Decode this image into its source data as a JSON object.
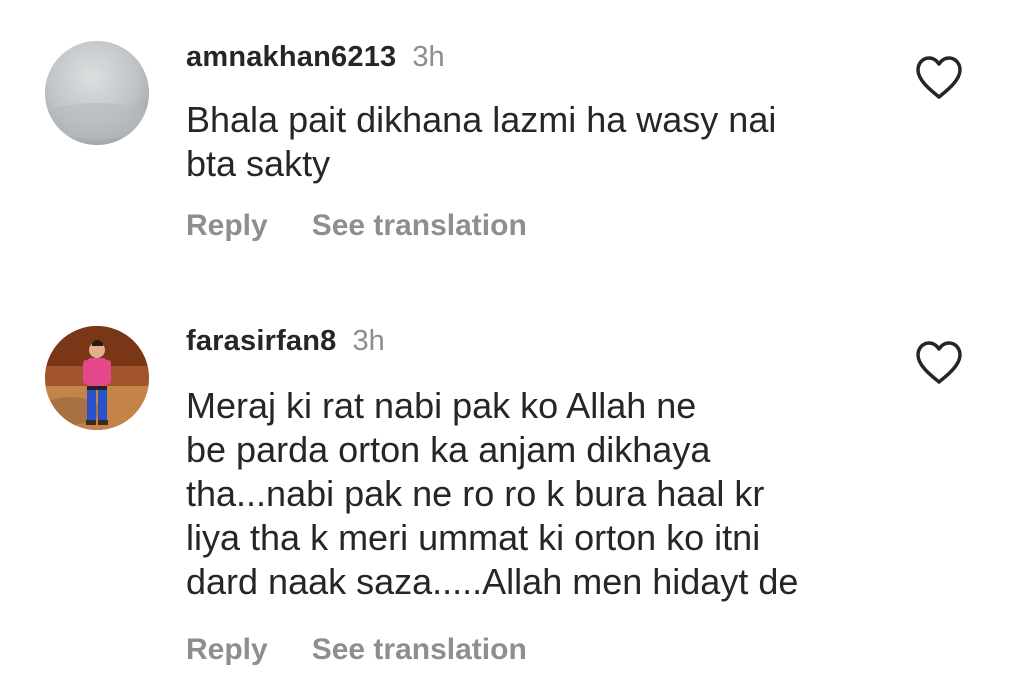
{
  "comments": [
    {
      "username": "amnakhan6213",
      "time": "3h",
      "text_lines": [
        "Bhala pait dikhana lazmi ha wasy nai",
        "bta sakty"
      ],
      "reply_label": "Reply",
      "translate_label": "See translation",
      "avatar_icon": "blurred-grey-profile-photo",
      "like_icon": "heart-outline-icon"
    },
    {
      "username": "farasirfan8",
      "time": "3h",
      "text_lines": [
        "Meraj ki rat nabi pak ko Allah ne",
        "be parda orton ka anjam dikhaya",
        "tha...nabi pak ne ro ro k bura haal kr",
        "liya tha k meri ummat ki orton ko itni",
        "dard naak saza.....Allah men hidayt de"
      ],
      "reply_label": "Reply",
      "translate_label": "See translation",
      "avatar_icon": "child-in-pink-shirt-photo",
      "like_icon": "heart-outline-icon"
    }
  ],
  "colors": {
    "text_primary": "#262626",
    "text_secondary": "#8e8e8e",
    "background": "#ffffff"
  }
}
